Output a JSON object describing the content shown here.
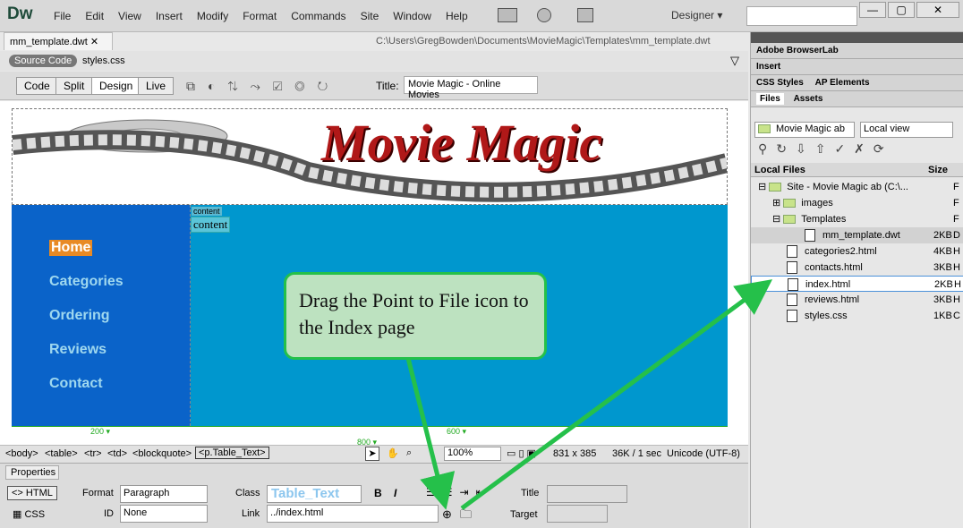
{
  "app": {
    "logo": "Dw",
    "workspace": "Designer"
  },
  "menu": [
    "File",
    "Edit",
    "View",
    "Insert",
    "Modify",
    "Format",
    "Commands",
    "Site",
    "Window",
    "Help"
  ],
  "document": {
    "tab": "mm_template.dwt",
    "path": "C:\\Users\\GregBowden\\Documents\\MovieMagic\\Templates\\mm_template.dwt",
    "related_source": "Source Code",
    "related_css": "styles.css"
  },
  "view_buttons": [
    "Code",
    "Split",
    "Design",
    "Live"
  ],
  "title_label": "Title:",
  "title_value": "Movie Magic - Online Movies",
  "banner_text": "Movie Magic",
  "nav": [
    "Home",
    "Categories",
    "Ordering",
    "Reviews",
    "Contact"
  ],
  "editable_region": {
    "tag": "content",
    "text": "content"
  },
  "widths": {
    "left": "200",
    "right": "600",
    "total": "800"
  },
  "tag_selector": [
    "<body>",
    "<table>",
    "<tr>",
    "<td>",
    "<blockquote>",
    "<p.Table_Text>"
  ],
  "status": {
    "zoom": "100%",
    "size": "831 x 385",
    "download": "36K / 1 sec",
    "encoding": "Unicode (UTF-8)"
  },
  "properties": {
    "title": "Properties",
    "html_btn": "HTML",
    "css_btn": "CSS",
    "format_label": "Format",
    "format_value": "Paragraph",
    "id_label": "ID",
    "id_value": "None",
    "class_label": "Class",
    "class_value": "Table_Text",
    "link_label": "Link",
    "link_value": "../index.html",
    "title_label": "Title",
    "target_label": "Target",
    "bold": "B",
    "italic": "I"
  },
  "right_panel": {
    "browserlab": "Adobe BrowserLab",
    "insert": "Insert",
    "css_styles": "CSS Styles",
    "ap_elements": "AP Elements",
    "files_tab": "Files",
    "assets_tab": "Assets",
    "site_select": "Movie Magic ab",
    "view_select": "Local view",
    "col_local": "Local Files",
    "col_size": "Size",
    "files": [
      {
        "name": "Site - Movie Magic ab (C:\\...",
        "size": "",
        "type": "F",
        "kind": "site"
      },
      {
        "name": "images",
        "size": "",
        "type": "F",
        "kind": "folder"
      },
      {
        "name": "Templates",
        "size": "",
        "type": "F",
        "kind": "folder"
      },
      {
        "name": "mm_template.dwt",
        "size": "2KB",
        "type": "D",
        "kind": "file"
      },
      {
        "name": "categories2.html",
        "size": "4KB",
        "type": "H",
        "kind": "file"
      },
      {
        "name": "contacts.html",
        "size": "3KB",
        "type": "H",
        "kind": "file"
      },
      {
        "name": "index.html",
        "size": "2KB",
        "type": "H",
        "kind": "file"
      },
      {
        "name": "reviews.html",
        "size": "3KB",
        "type": "H",
        "kind": "file"
      },
      {
        "name": "styles.css",
        "size": "1KB",
        "type": "C",
        "kind": "file"
      }
    ]
  },
  "callout": "Drag the Point to File icon to the Index page",
  "colors": {
    "accent_green": "#25c04a",
    "nav_bg": "#0a63c9",
    "content_bg": "#0097ce",
    "home_bg": "#e88a25"
  }
}
